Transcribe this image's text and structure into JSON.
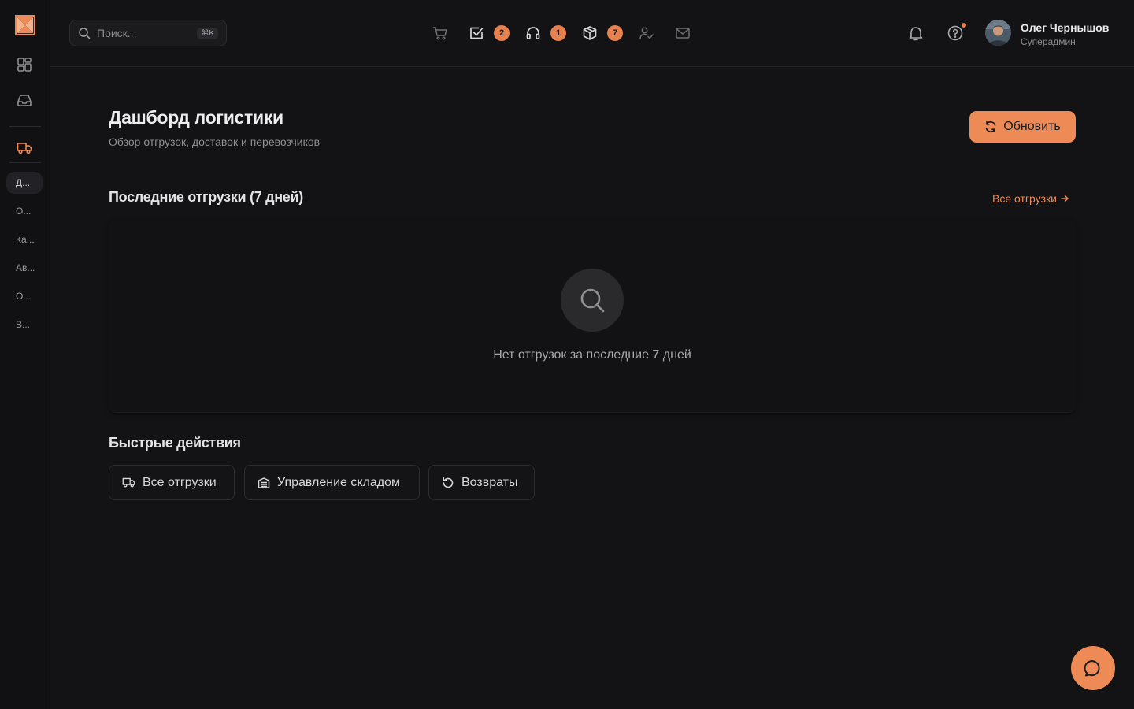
{
  "colors": {
    "accent": "#ee8a56",
    "background": "#131315",
    "sidebar": "#111113"
  },
  "sidebar": {
    "logo": "brand-logo",
    "icons": [
      "dashboard-icon",
      "inbox-icon",
      "truck-icon"
    ],
    "items": [
      {
        "label": "Д..."
      },
      {
        "label": "О..."
      },
      {
        "label": "Ка..."
      },
      {
        "label": "Ав..."
      },
      {
        "label": "О..."
      },
      {
        "label": "В..."
      }
    ]
  },
  "topbar": {
    "search": {
      "placeholder": "Поиск...",
      "shortcut": "⌘K"
    },
    "quick_icons": [
      {
        "icon": "cart-icon",
        "badge": ""
      },
      {
        "icon": "checkbox-icon",
        "badge": "2"
      },
      {
        "icon": "headphones-icon",
        "badge": "1"
      },
      {
        "icon": "package-icon",
        "badge": "7"
      },
      {
        "icon": "user-check-icon",
        "badge": ""
      },
      {
        "icon": "mail-icon",
        "badge": ""
      }
    ],
    "user": {
      "name": "Олег Чернышов",
      "role": "Суперадмин"
    }
  },
  "main": {
    "title": "Дашборд логистики",
    "subtitle": "Обзор отгрузок, доставок и перевозчиков",
    "refresh_label": "Обновить",
    "recent": {
      "title": "Последние отгрузки (7 дней)",
      "link": "Все отгрузки",
      "empty_text": "Нет отгрузок за последние 7 дней"
    },
    "quick_actions": {
      "title": "Быстрые действия",
      "buttons": [
        {
          "label": "Все отгрузки"
        },
        {
          "label": "Управление складом"
        },
        {
          "label": "Возвраты"
        }
      ]
    }
  }
}
